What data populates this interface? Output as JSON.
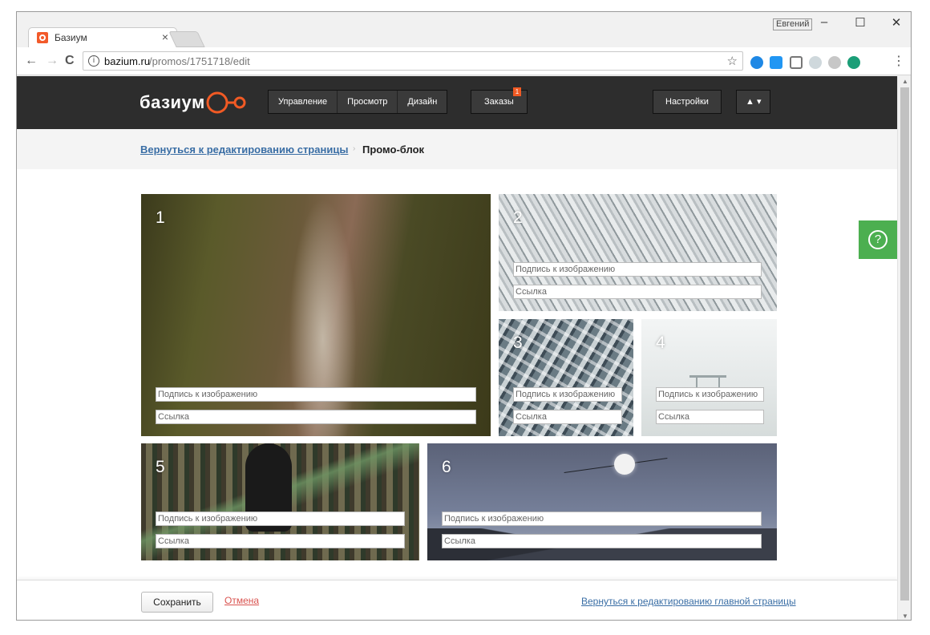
{
  "browser": {
    "tab_title": "Базиум",
    "tab_close": "×",
    "user_name": "Евгений",
    "min": "–",
    "max": "☐",
    "close": "✕",
    "url_host": "bazium.ru",
    "url_path": "/promos/1751718/edit",
    "back": "←",
    "forward": "→",
    "reload": "C",
    "star": "☆",
    "menu": "⋮",
    "info": "i"
  },
  "header": {
    "logo": "базиум",
    "nav": [
      "Управление",
      "Просмотр",
      "Дизайн"
    ],
    "orders": "Заказы",
    "orders_badge": "1",
    "settings": "Настройки",
    "user_menu": "▲ ▾"
  },
  "breadcrumb": {
    "back_link": "Вернуться к редактированию страницы",
    "separator": "›",
    "current": "Промо-блок"
  },
  "tiles": [
    {
      "number": "1",
      "caption_placeholder": "Подпись к изображению",
      "link_placeholder": "Ссылка"
    },
    {
      "number": "2",
      "caption_placeholder": "Подпись к изображению",
      "link_placeholder": "Ссылка"
    },
    {
      "number": "3",
      "caption_placeholder": "Подпись к изображению",
      "link_placeholder": "Ссылка"
    },
    {
      "number": "4",
      "caption_placeholder": "Подпись к изображению",
      "link_placeholder": "Ссылка"
    },
    {
      "number": "5",
      "caption_placeholder": "Подпись к изображению",
      "link_placeholder": "Ссылка"
    },
    {
      "number": "6",
      "caption_placeholder": "Подпись к изображению",
      "link_placeholder": "Ссылка"
    }
  ],
  "help": "?",
  "footer": {
    "save": "Сохранить",
    "cancel": "Отмена",
    "back_main": "Вернуться к редактированию главной страницы"
  },
  "colors": {
    "header_bg": "#2d2d2d",
    "logo_accent": "#f15a24",
    "link": "#3a6ea5",
    "cancel": "#d9534f",
    "help_bg": "#4caf50"
  }
}
